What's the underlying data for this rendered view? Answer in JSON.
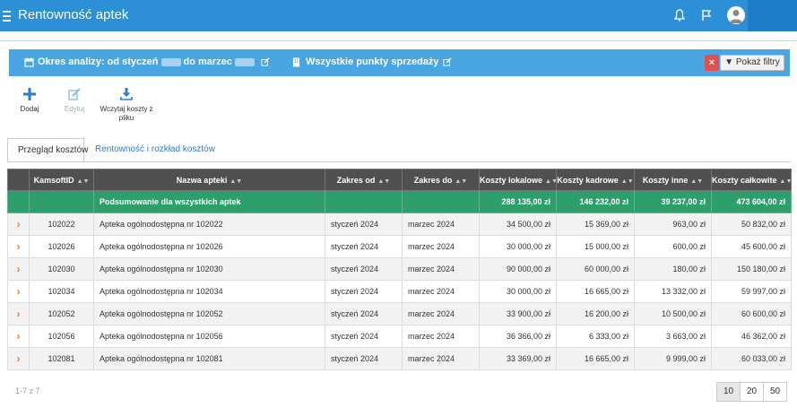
{
  "app": {
    "title": "Rentowność aptek"
  },
  "analysis": {
    "period_prefix": "Okres analizy: od styczeń",
    "period_mid": "do marzec",
    "points_label": "Wszystkie punkty sprzedaży",
    "show_filters": "Pokaż filtry",
    "clear": "×"
  },
  "toolbar": [
    {
      "label": "Dodaj",
      "icon": "plus-icon",
      "enabled": true
    },
    {
      "label": "Edytuj",
      "icon": "pencil-icon",
      "enabled": false
    },
    {
      "label": "Wczytaj koszty z pliku",
      "icon": "download-icon",
      "enabled": true
    }
  ],
  "tabs": [
    {
      "label": "Przegląd kosztów",
      "active": true
    },
    {
      "label": "Rentowność i rozkład kosztów",
      "active": false
    }
  ],
  "table": {
    "columns": [
      "KamsoftID",
      "Nazwa apteki",
      "Zakres od",
      "Zakres do",
      "Koszty lokalowe",
      "Koszty kadrowe",
      "Koszty inne",
      "Koszty całkowite"
    ],
    "summary": {
      "name": "Podsumowanie dla wszystkich aptek",
      "lokalowe": "288 135,00 zł",
      "kadrowe": "146 232,00 zł",
      "inne": "39 237,00 zł",
      "calkowite": "473 604,00 zł"
    },
    "rows": [
      {
        "id": "102022",
        "name": "Apteka ogólnodostępna nr 102022",
        "from": "styczeń 2024",
        "to": "marzec 2024",
        "lokalowe": "34 500,00 zł",
        "kadrowe": "15 369,00 zł",
        "inne": "963,00 zł",
        "calkowite": "50 832,00 zł"
      },
      {
        "id": "102026",
        "name": "Apteka ogólnodostępna nr 102026",
        "from": "styczeń 2024",
        "to": "marzec 2024",
        "lokalowe": "30 000,00 zł",
        "kadrowe": "15 000,00 zł",
        "inne": "600,00 zł",
        "calkowite": "45 600,00 zł"
      },
      {
        "id": "102030",
        "name": "Apteka ogólnodostępna nr 102030",
        "from": "styczeń 2024",
        "to": "marzec 2024",
        "lokalowe": "90 000,00 zł",
        "kadrowe": "60 000,00 zł",
        "inne": "180,00 zł",
        "calkowite": "150 180,00 zł"
      },
      {
        "id": "102034",
        "name": "Apteka ogólnodostępna nr 102034",
        "from": "styczeń 2024",
        "to": "marzec 2024",
        "lokalowe": "30 000,00 zł",
        "kadrowe": "16 665,00 zł",
        "inne": "13 332,00 zł",
        "calkowite": "59 997,00 zł"
      },
      {
        "id": "102052",
        "name": "Apteka ogólnodostępna nr 102052",
        "from": "styczeń 2024",
        "to": "marzec 2024",
        "lokalowe": "33 900,00 zł",
        "kadrowe": "16 200,00 zł",
        "inne": "10 500,00 zł",
        "calkowite": "60 600,00 zł"
      },
      {
        "id": "102056",
        "name": "Apteka ogólnodostępna nr 102056",
        "from": "styczeń 2024",
        "to": "marzec 2024",
        "lokalowe": "36 366,00 zł",
        "kadrowe": "6 333,00 zł",
        "inne": "3 663,00 zł",
        "calkowite": "46 362,00 zł"
      },
      {
        "id": "102081",
        "name": "Apteka ogólnodostępna nr 102081",
        "from": "styczeń 2024",
        "to": "marzec 2024",
        "lokalowe": "33 369,00 zł",
        "kadrowe": "16 665,00 zł",
        "inne": "9 999,00 zł",
        "calkowite": "60 033,00 zł"
      }
    ]
  },
  "pager": {
    "info": "1-7 z 7",
    "sizes": [
      "10",
      "20",
      "50"
    ],
    "selected": "10"
  },
  "colors": {
    "topbar": "#2d8fd5",
    "analysis": "#4aa6e2",
    "summary": "#2e9e6c",
    "header": "#505050",
    "chevron": "#e8841e"
  }
}
